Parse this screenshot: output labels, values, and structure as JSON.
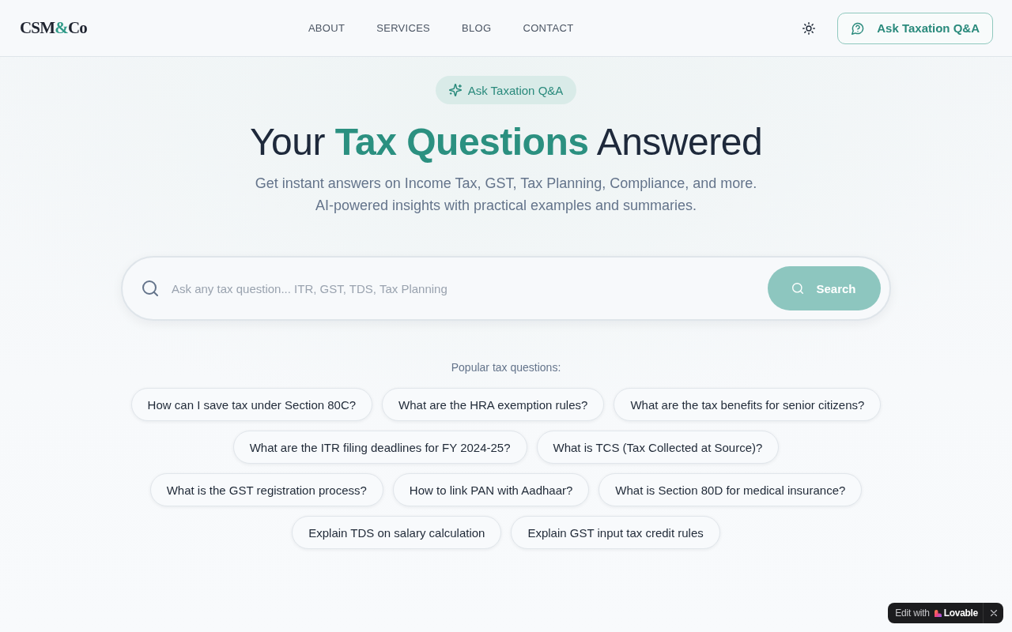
{
  "header": {
    "logo": {
      "parts": [
        {
          "text": "CSM",
          "accent": false
        },
        {
          "text": "&",
          "accent": true
        },
        {
          "text": "Co",
          "accent": false
        }
      ]
    },
    "nav": [
      {
        "label": "ABOUT"
      },
      {
        "label": "SERVICES"
      },
      {
        "label": "BLOG"
      },
      {
        "label": "CONTACT"
      }
    ],
    "cta_button": {
      "label": "Ask Taxation Q&A"
    }
  },
  "hero": {
    "badge": "Ask Taxation Q&A",
    "headline": [
      {
        "text": "Your ",
        "accent": false
      },
      {
        "text": "Tax Questions",
        "accent": true
      },
      {
        "text": " Answered",
        "accent": false
      }
    ],
    "subtitle_lines": [
      "Get instant answers on Income Tax, GST, Tax Planning, Compliance, and more.",
      "AI-powered insights with practical examples and summaries."
    ]
  },
  "search": {
    "placeholder": "Ask any tax question... ITR, GST, TDS, Tax Planning",
    "button": "Search"
  },
  "popular": {
    "title": "Popular tax questions:",
    "questions": [
      "How can I save tax under Section 80C?",
      "What are the HRA exemption rules?",
      "What are the tax benefits for senior citizens?",
      "What are the ITR filing deadlines for FY 2024-25?",
      "What is TCS (Tax Collected at Source)?",
      "What is the GST registration process?",
      "How to link PAN with Aadhaar?",
      "What is Section 80D for medical insurance?",
      "Explain TDS on salary calculation",
      "Explain GST input tax credit rules"
    ]
  },
  "lovable_badge": {
    "prefix": "Edit with",
    "brand": "Lovable"
  }
}
